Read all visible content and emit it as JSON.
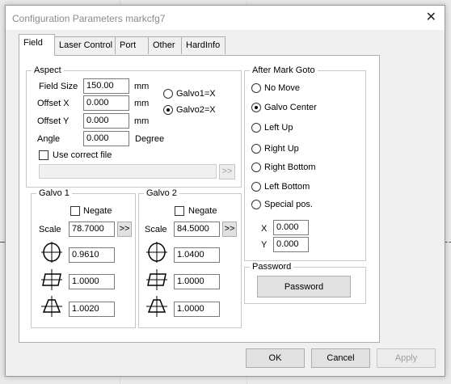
{
  "window": {
    "title": "Configuration Parameters markcfg7"
  },
  "tabs": [
    {
      "label": "Field"
    },
    {
      "label": "Laser Control"
    },
    {
      "label": "Port"
    },
    {
      "label": "Other"
    },
    {
      "label": "HardInfo"
    }
  ],
  "aspect": {
    "title": "Aspect",
    "field_size": {
      "label": "Field Size",
      "value": "150.00",
      "unit": "mm"
    },
    "offset_x": {
      "label": "Offset X",
      "value": "0.000",
      "unit": "mm"
    },
    "offset_y": {
      "label": "Offset Y",
      "value": "0.000",
      "unit": "mm"
    },
    "angle": {
      "label": "Angle",
      "value": "0.000",
      "unit": "Degree"
    },
    "galvo1_x": {
      "label": "Galvo1=X",
      "checked": false
    },
    "galvo2_x": {
      "label": "Galvo2=X",
      "checked": true
    },
    "use_correct_file": {
      "label": "Use correct file",
      "checked": false
    },
    "file_path": "",
    "browse_label": ">>"
  },
  "galvo1": {
    "title": "Galvo 1",
    "negate": {
      "label": "Negate",
      "checked": false
    },
    "scale": {
      "label": "Scale",
      "value": "78.7000"
    },
    "arrow_label": ">>",
    "barrel": "0.9610",
    "parallelogram": "1.0000",
    "trapezoid": "1.0020"
  },
  "galvo2": {
    "title": "Galvo 2",
    "negate": {
      "label": "Negate",
      "checked": false
    },
    "scale": {
      "label": "Scale",
      "value": "84.5000"
    },
    "arrow_label": ">>",
    "barrel": "1.0400",
    "parallelogram": "1.0000",
    "trapezoid": "1.0000"
  },
  "after_mark": {
    "title": "After Mark Goto",
    "options": [
      {
        "label": "No Move",
        "checked": false
      },
      {
        "label": "Galvo Center",
        "checked": true
      },
      {
        "label": "Left Up",
        "checked": false
      },
      {
        "label": "Right Up",
        "checked": false
      },
      {
        "label": "Right Bottom",
        "checked": false
      },
      {
        "label": "Left Bottom",
        "checked": false
      },
      {
        "label": "Special pos.",
        "checked": false
      }
    ],
    "x_label": "X",
    "x_value": "0.000",
    "y_label": "Y",
    "y_value": "0.000"
  },
  "password": {
    "title": "Password",
    "button_label": "Password"
  },
  "footer": {
    "ok": "OK",
    "cancel": "Cancel",
    "apply": "Apply"
  },
  "icons": {
    "barrel": "barrel-distortion-icon",
    "parallelogram": "parallelogram-distortion-icon",
    "trapezoid": "trapezoid-distortion-icon"
  }
}
